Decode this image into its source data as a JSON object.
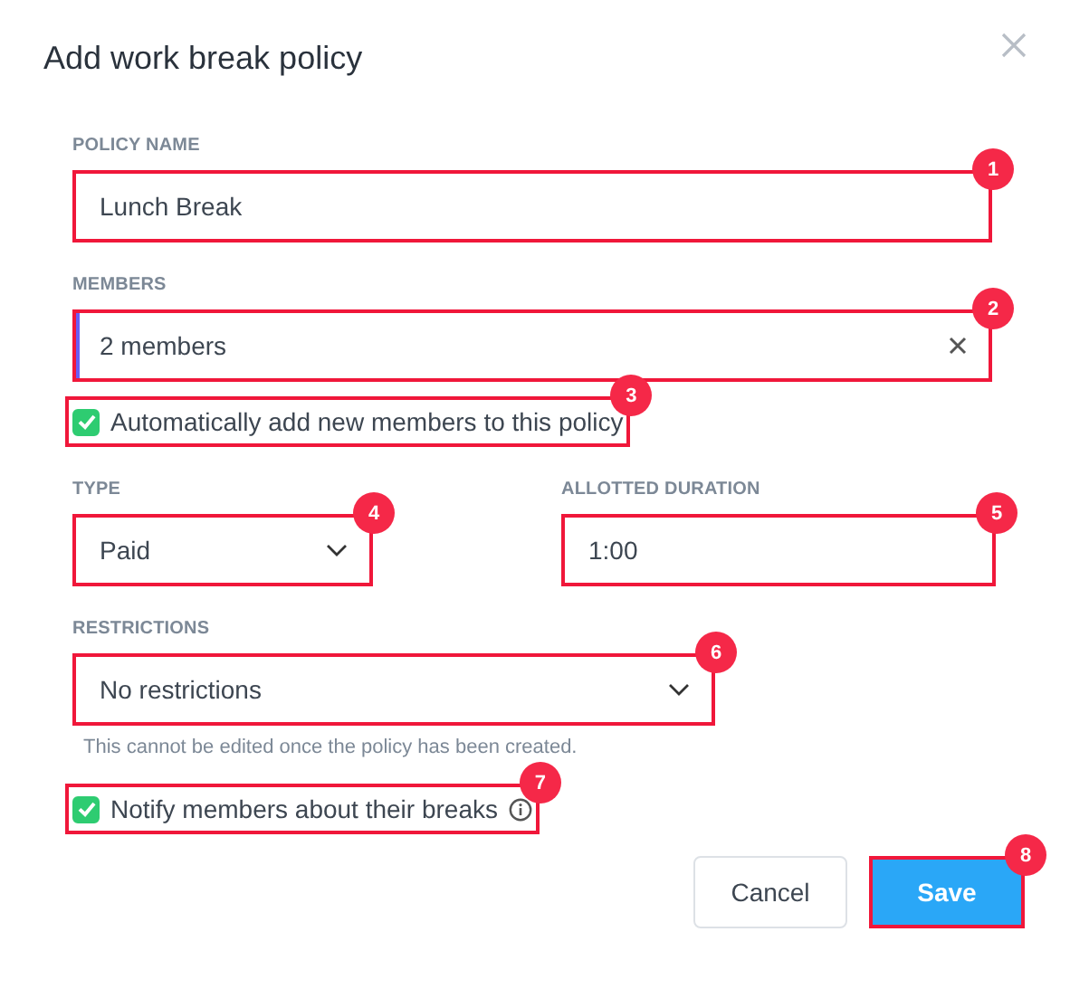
{
  "title": "Add work break policy",
  "policy_name": {
    "label": "POLICY NAME",
    "value": "Lunch Break",
    "callout": "1"
  },
  "members": {
    "label": "MEMBERS",
    "value": "2 members",
    "focused": true,
    "callout": "2"
  },
  "auto_add": {
    "label": "Automatically add new members to this policy",
    "checked": true,
    "callout": "3"
  },
  "type": {
    "label": "TYPE",
    "value": "Paid",
    "callout": "4"
  },
  "allotted_duration": {
    "label": "ALLOTTED DURATION",
    "value": "1:00",
    "callout": "5"
  },
  "restrictions": {
    "label": "RESTRICTIONS",
    "value": "No restrictions",
    "hint": "This cannot be edited once the policy has been created.",
    "callout": "6"
  },
  "notify": {
    "label": "Notify members about their breaks",
    "checked": true,
    "callout": "7"
  },
  "buttons": [
    {
      "label": "Cancel",
      "kind": "secondary"
    },
    {
      "label": "Save",
      "kind": "primary",
      "callout": "8"
    }
  ]
}
